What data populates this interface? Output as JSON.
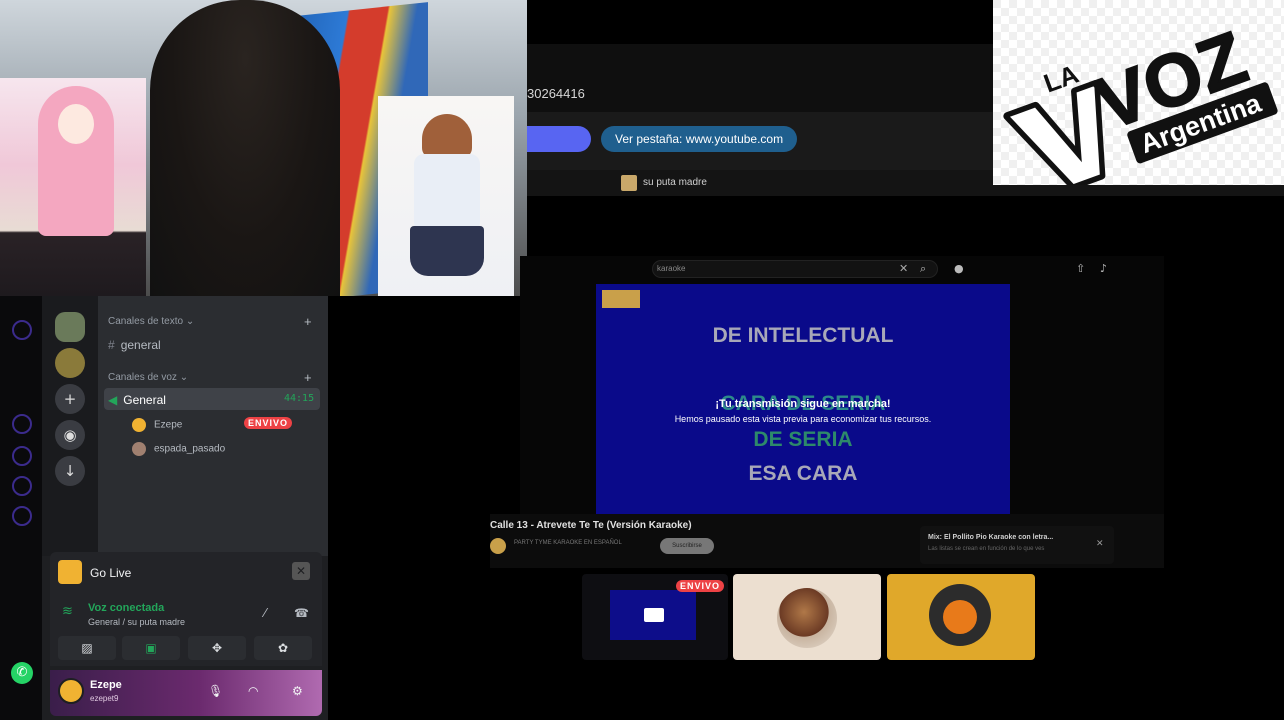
{
  "logo": {
    "line1": "LA",
    "line2": "VOZ",
    "line3": "Argentina"
  },
  "browser": {
    "id_text": "30264416",
    "view_tab_label": "Ver pestaña: www.youtube.com",
    "status_text": "su puta madre"
  },
  "youtube": {
    "search_query": "karaoke",
    "lyrics": [
      "DE INTELECTUAL",
      "CARA DE SERIA",
      "DE SERIA",
      "ESA CARA"
    ],
    "notice_title": "¡Tu transmisión sigue en marcha!",
    "notice_body": "Hemos pausado esta vista previa para economizar tus recursos.",
    "video_title": "Calle 13 - Atrevete Te Te (Versión Karaoke)",
    "channel_name": "PARTY TYME KARAOKE EN ESPAÑOL",
    "subscribe_label": "Suscribirse",
    "mix_title": "Mix: El Pollito Pio Karaoke con letra...",
    "mix_subtitle": "Las listas se crean en función de lo que ves"
  },
  "discord": {
    "categories": {
      "text": "Canales de texto",
      "voice": "Canales de voz"
    },
    "text_channel": "general",
    "voice_channel": "General",
    "voice_timer": "44:15",
    "voice_users": [
      {
        "name": "Ezepe",
        "badge": "ENVIVO"
      },
      {
        "name": "espada_pasado",
        "badge": ""
      }
    ],
    "go_live_label": "Go Live",
    "voice_connected": "Voz conectada",
    "voice_location": "General / su puta madre",
    "user": {
      "name": "Ezepe",
      "tag": "ezepet9"
    }
  },
  "stream_tiles": {
    "live_badge": "ENVIVO"
  },
  "colors": {
    "accent_green": "#23a55a",
    "live_red": "#ed4245",
    "blurple": "#5865f2"
  }
}
